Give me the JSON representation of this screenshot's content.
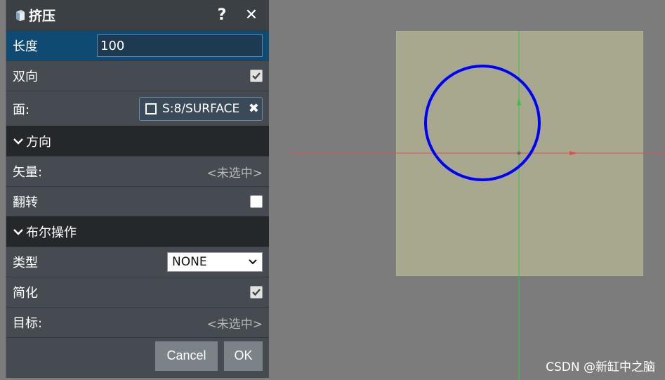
{
  "dialog": {
    "title": "挤压",
    "help": "?",
    "close": "✕",
    "fields": {
      "length_label": "长度",
      "length_value": "100",
      "bidirectional_label": "双向",
      "bidirectional_checked": true,
      "face_label": "面:",
      "face_value": "S:8/SURFACE"
    },
    "direction_section": {
      "title": "方向",
      "vector_label": "矢量:",
      "vector_value": "<未选中>",
      "flip_label": "翻转",
      "flip_checked": false
    },
    "boolean_section": {
      "title": "布尔操作",
      "type_label": "类型",
      "type_value": "NONE",
      "simplify_label": "简化",
      "simplify_checked": true,
      "target_label": "目标:",
      "target_value": "<未选中>"
    },
    "cancel_label": "Cancel",
    "ok_label": "OK"
  },
  "viewport": {
    "watermark": "CSDN @新缸中之脑"
  },
  "colors": {
    "panel_bg": "#454b50",
    "active_row": "#0f4a72",
    "section_bg": "#25282b",
    "viewport_bg": "#7c7c7c",
    "plane": "#a8a88e",
    "circle": "#0000ff",
    "x_axis": "#e05050",
    "y_axis": "#40c040"
  }
}
